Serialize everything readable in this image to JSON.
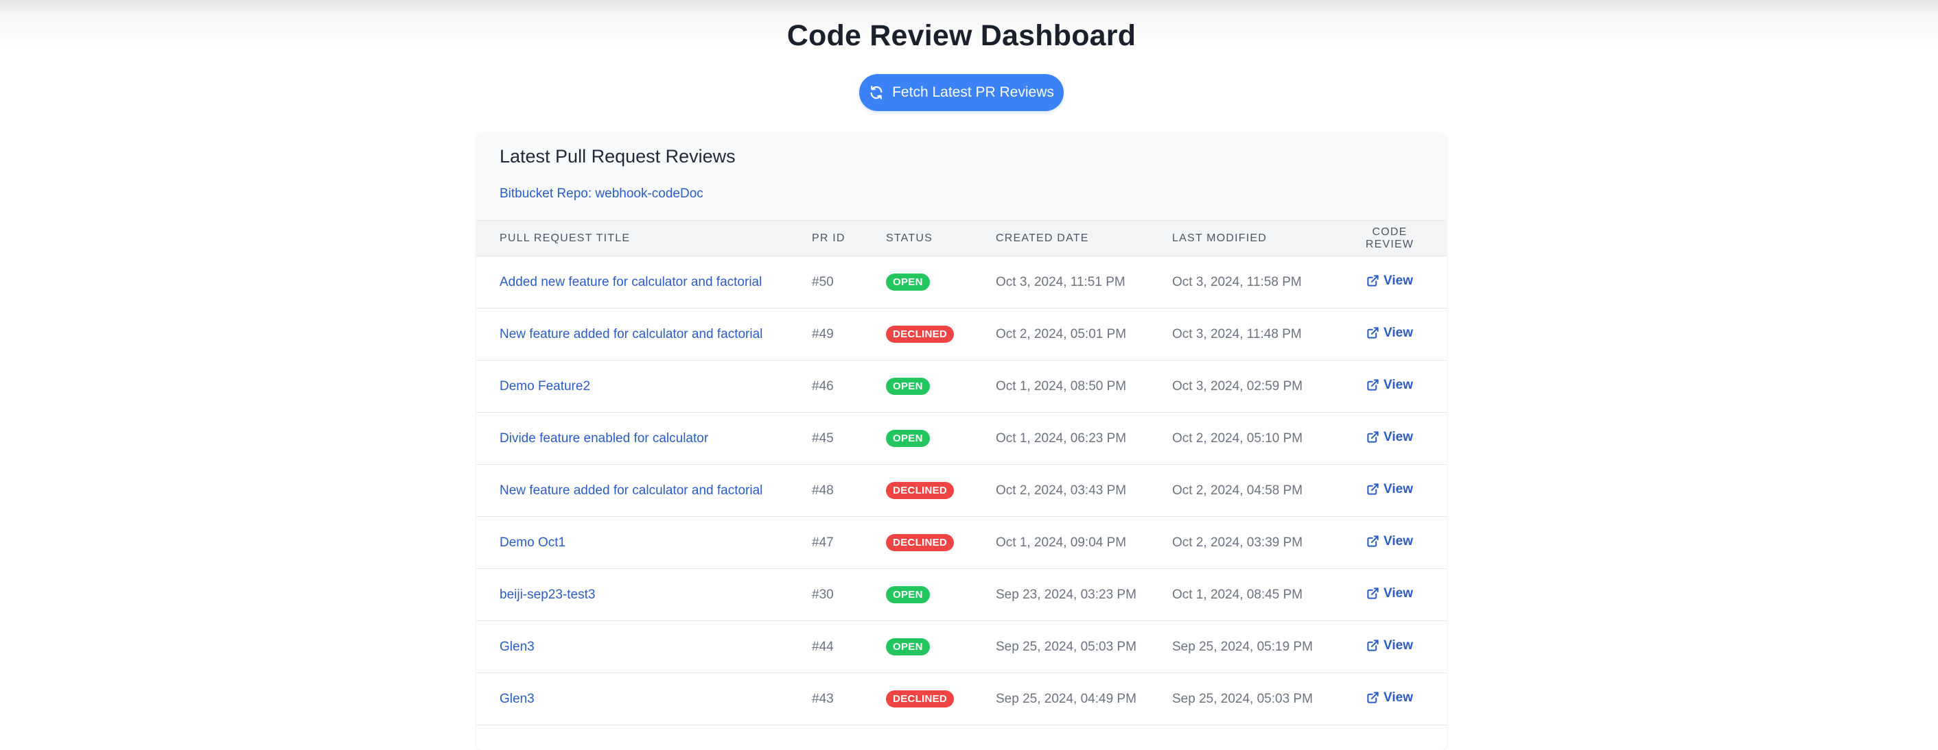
{
  "header": {
    "title": "Code Review Dashboard",
    "fetch_button_label": "Fetch Latest PR Reviews"
  },
  "card": {
    "title": "Latest Pull Request Reviews",
    "repo_link": "Bitbucket Repo: webhook-codeDoc"
  },
  "table": {
    "columns": [
      "Pull Request Title",
      "PR ID",
      "Status",
      "Created Date",
      "Last Modified",
      "Code Review"
    ],
    "rows": [
      {
        "title": "Added new feature for calculator and factorial",
        "id": "#50",
        "status": "OPEN",
        "created": "Oct 3, 2024, 11:51 PM",
        "modified": "Oct 3, 2024, 11:58 PM",
        "review": "View"
      },
      {
        "title": "New feature added for calculator and factorial",
        "id": "#49",
        "status": "DECLINED",
        "created": "Oct 2, 2024, 05:01 PM",
        "modified": "Oct 3, 2024, 11:48 PM",
        "review": "View"
      },
      {
        "title": "Demo Feature2",
        "id": "#46",
        "status": "OPEN",
        "created": "Oct 1, 2024, 08:50 PM",
        "modified": "Oct 3, 2024, 02:59 PM",
        "review": "View"
      },
      {
        "title": "Divide feature enabled for calculator",
        "id": "#45",
        "status": "OPEN",
        "created": "Oct 1, 2024, 06:23 PM",
        "modified": "Oct 2, 2024, 05:10 PM",
        "review": "View"
      },
      {
        "title": "New feature added for calculator and factorial",
        "id": "#48",
        "status": "DECLINED",
        "created": "Oct 2, 2024, 03:43 PM",
        "modified": "Oct 2, 2024, 04:58 PM",
        "review": "View"
      },
      {
        "title": "Demo Oct1",
        "id": "#47",
        "status": "DECLINED",
        "created": "Oct 1, 2024, 09:04 PM",
        "modified": "Oct 2, 2024, 03:39 PM",
        "review": "View"
      },
      {
        "title": "beiji-sep23-test3",
        "id": "#30",
        "status": "OPEN",
        "created": "Sep 23, 2024, 03:23 PM",
        "modified": "Oct 1, 2024, 08:45 PM",
        "review": "View"
      },
      {
        "title": "Glen3",
        "id": "#44",
        "status": "OPEN",
        "created": "Sep 25, 2024, 05:03 PM",
        "modified": "Sep 25, 2024, 05:19 PM",
        "review": "View"
      },
      {
        "title": "Glen3",
        "id": "#43",
        "status": "DECLINED",
        "created": "Sep 25, 2024, 04:49 PM",
        "modified": "Sep 25, 2024, 05:03 PM",
        "review": "View"
      }
    ]
  },
  "colors": {
    "primary": "#3b82f6",
    "link": "#2b5cc4",
    "open": "#22c55e",
    "declined": "#ef4444"
  },
  "icons": {
    "fetch_button": "refresh-icon",
    "view_link": "external-link-icon"
  }
}
